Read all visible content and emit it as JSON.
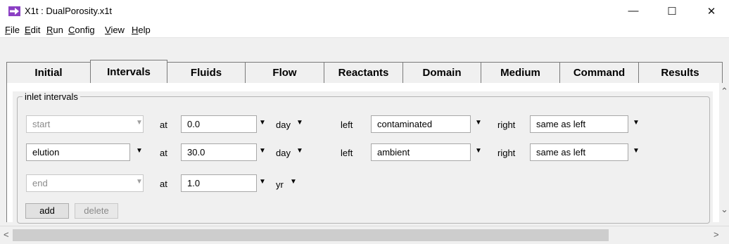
{
  "window": {
    "title": "X1t : DualPorosity.x1t"
  },
  "menu": [
    "File",
    "Edit",
    "Run",
    "Config",
    "View",
    "Help"
  ],
  "tabs": [
    "Initial",
    "Intervals",
    "Fluids",
    "Flow",
    "Reactants",
    "Domain",
    "Medium",
    "Command",
    "Results"
  ],
  "active_tab": "Intervals",
  "group": {
    "legend": "inlet intervals"
  },
  "labels": {
    "at": "at",
    "left": "left",
    "right": "right"
  },
  "rows": [
    {
      "name": "start",
      "time": "0.0",
      "unit": "day",
      "left": "contaminated",
      "right": "same as left"
    },
    {
      "name": "elution",
      "time": "30.0",
      "unit": "day",
      "left": "ambient",
      "right": "same as left"
    },
    {
      "name": "end",
      "time": "1.0",
      "unit": "yr"
    }
  ],
  "buttons": {
    "add": "add",
    "delete": "delete"
  }
}
